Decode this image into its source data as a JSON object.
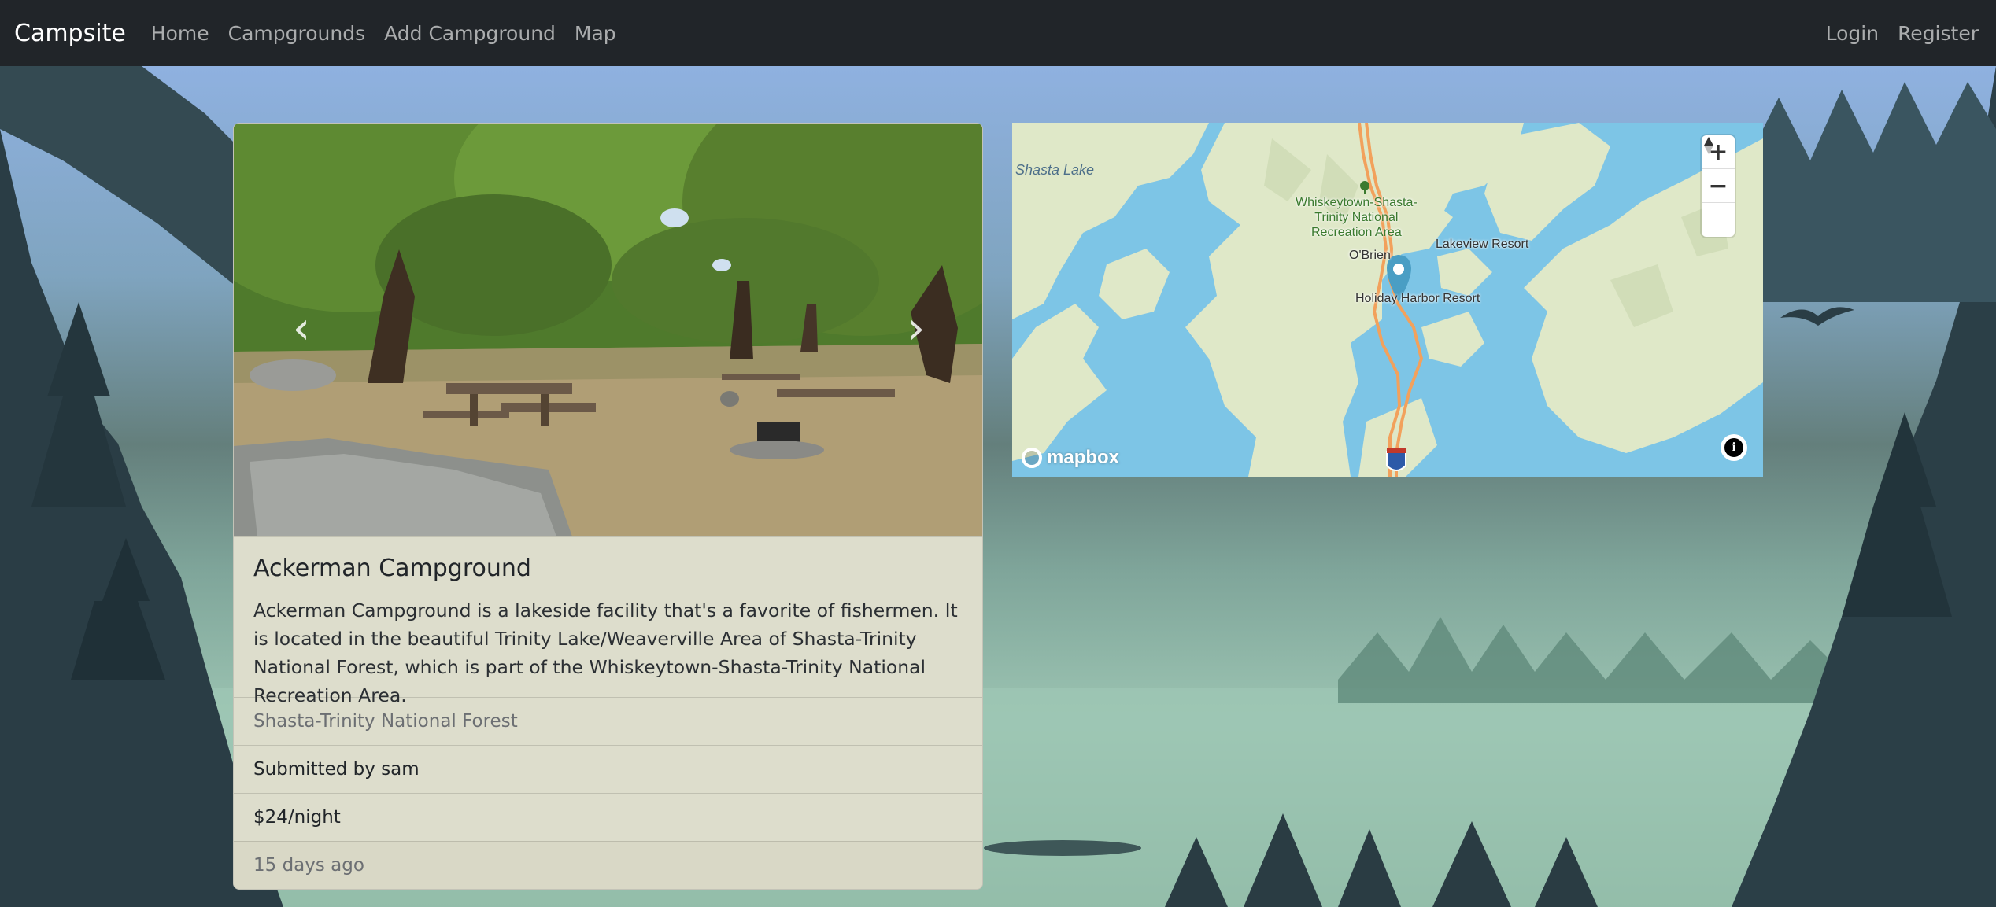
{
  "navbar": {
    "brand": "Campsite",
    "links": [
      "Home",
      "Campgrounds",
      "Add Campground",
      "Map"
    ],
    "right_links": [
      "Login",
      "Register"
    ]
  },
  "campground": {
    "image_alt": "Ackerman Campground photo",
    "title": "Ackerman Campground",
    "description": "Ackerman Campground is a lakeside facility that's a favorite of fishermen. It is located in the beautiful Trinity Lake/Weaverville Area of Shasta-Trinity National Forest, which is part of the Whiskeytown-Shasta-Trinity National Recreation Area.",
    "location": "Shasta-Trinity National Forest",
    "submitted_by": "Submitted by sam",
    "price": "$24/night",
    "posted": "15 days ago",
    "carousel_prev_icon": "chevron-left-icon",
    "carousel_next_icon": "chevron-right-icon"
  },
  "map": {
    "labels": {
      "water": "Shasta Lake",
      "rec_area_line1": "Whiskeytown-Shasta-",
      "rec_area_line2": "Trinity National",
      "rec_area_line3": "Recreation Area",
      "obrien": "O'Brien",
      "lakeview": "Lakeview Resort",
      "holiday": "Holiday Harbor Resort",
      "highway": "5"
    },
    "zoom_in": "+",
    "zoom_out": "−",
    "compass_icon": "compass-icon",
    "attribution_logo": "mapbox",
    "info_icon": "i",
    "colors": {
      "water": "#7dc5e6",
      "land": "#dfe8c8",
      "road": "#f0a060",
      "marker": "#4a9ec4"
    }
  }
}
